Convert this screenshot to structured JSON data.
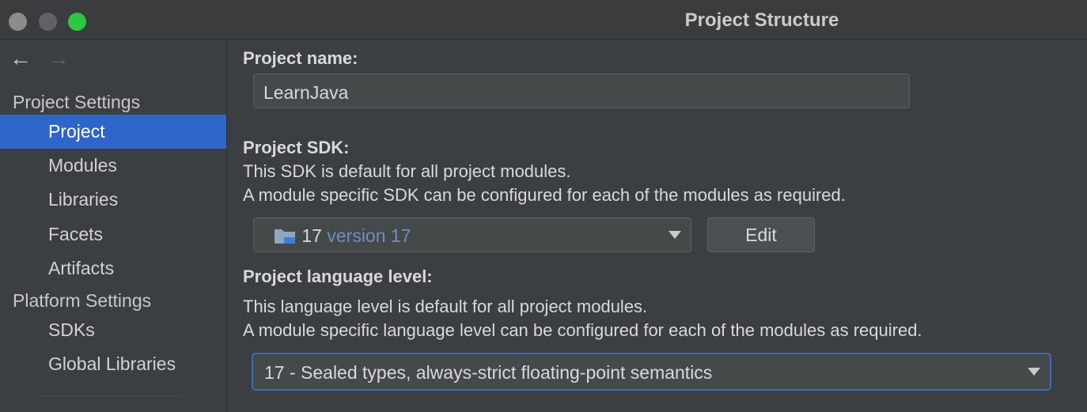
{
  "window": {
    "title": "Project Structure"
  },
  "sidebar": {
    "platform_section": "Project Settings",
    "project_items": [
      "Project",
      "Modules",
      "Libraries",
      "Facets",
      "Artifacts"
    ],
    "platform_settings_section": "Platform Settings",
    "platform_items": [
      "SDKs",
      "Global Libraries"
    ],
    "selected": "Project"
  },
  "main": {
    "project_name_label": "Project name:",
    "project_name_value": "LearnJava",
    "sdk_label": "Project SDK:",
    "sdk_desc_1": "This SDK is default for all project modules.",
    "sdk_desc_2": "A module specific SDK can be configured for each of the modules as required.",
    "sdk_value": "17",
    "sdk_version": "version 17",
    "edit_label": "Edit",
    "lang_label": "Project language level:",
    "lang_desc_1": "This language level is default for all project modules.",
    "lang_desc_2": "A module specific language level can be configured for each of the modules as required.",
    "lang_value": "17 - Sealed types, always-strict floating-point semantics"
  },
  "colors": {
    "accent": "#2e65ca",
    "close": "#8a8c8e",
    "maximize": "#2cc840"
  }
}
